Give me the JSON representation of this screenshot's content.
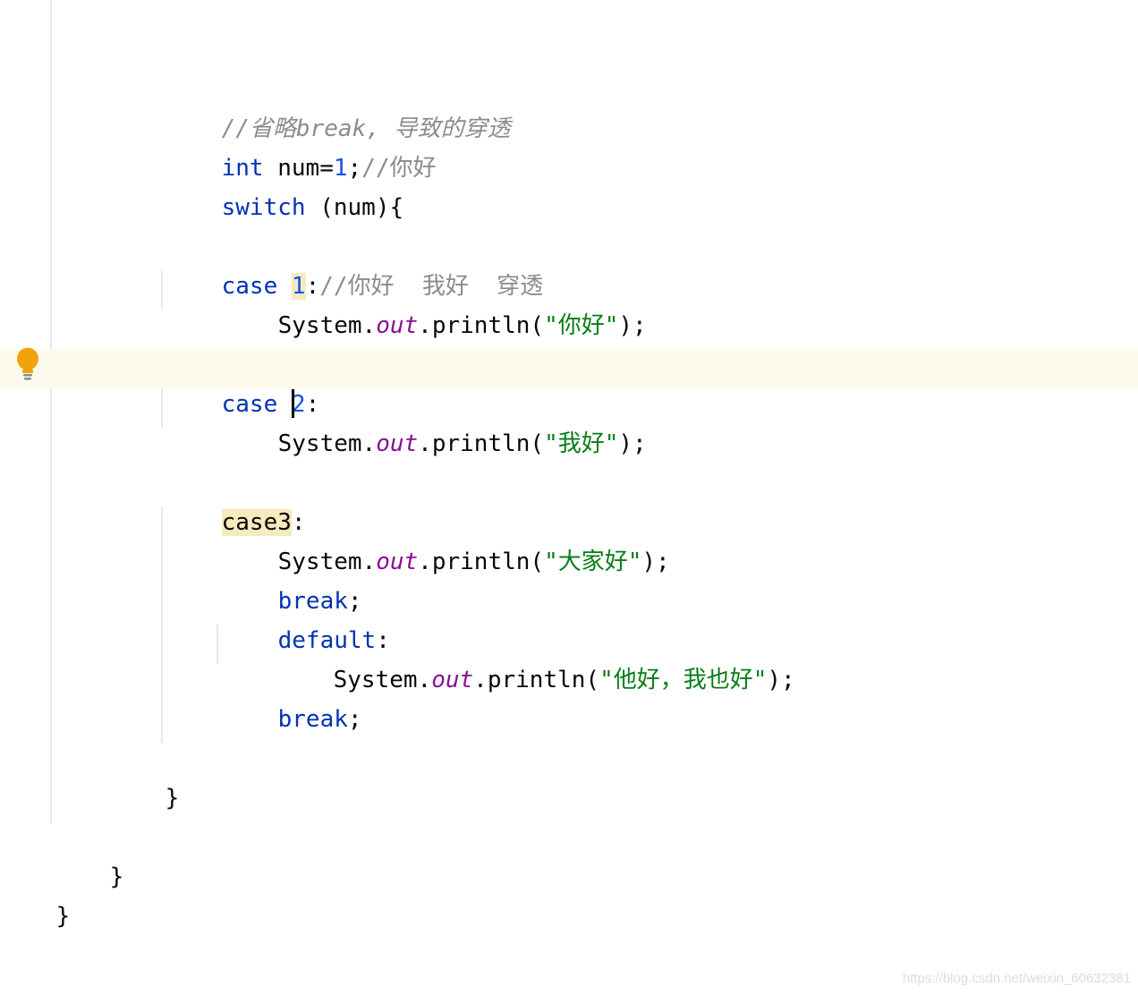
{
  "code": {
    "comment1": "//省略break, 导致的穿透",
    "l2_kw": "int",
    "l2_mid": " num=",
    "l2_num": "1",
    "l2_semi": ";",
    "l2_cmt": "//你好",
    "l3_kw": "switch",
    "l3_rest": " (num){",
    "l4_kw": "case",
    "l4_num": "1",
    "l4_colon": ":",
    "l4_cmt": "//你好  我好  穿透",
    "sys": "System.",
    "out": "out",
    "println": ".println(",
    "str_nihao": "\"你好\"",
    "close": ");",
    "l6_kw": "case",
    "l6_num": "2",
    "l6_colon": ":",
    "str_wohao": "\"我好\"",
    "l8_word": "case3",
    "l8_colon": ":",
    "str_dajiahao": "\"大家好\"",
    "break_kw": "break",
    "semi": ";",
    "default_kw": "default",
    "default_colon": ":",
    "str_tahao": "\"他好，我也好\"",
    "brace_switch": "}",
    "brace_method": "}",
    "brace_class": "}"
  },
  "watermark": "https://blog.csdn.net/weixin_60632381",
  "icons": {
    "intention": "lightbulb-icon"
  },
  "colors": {
    "keyword": "#0033b3",
    "number": "#1750eb",
    "string": "#067d17",
    "field": "#871094",
    "comment": "#8c8c8c",
    "current_line": "#fcfaed",
    "highlight": "#f6ebbc"
  }
}
